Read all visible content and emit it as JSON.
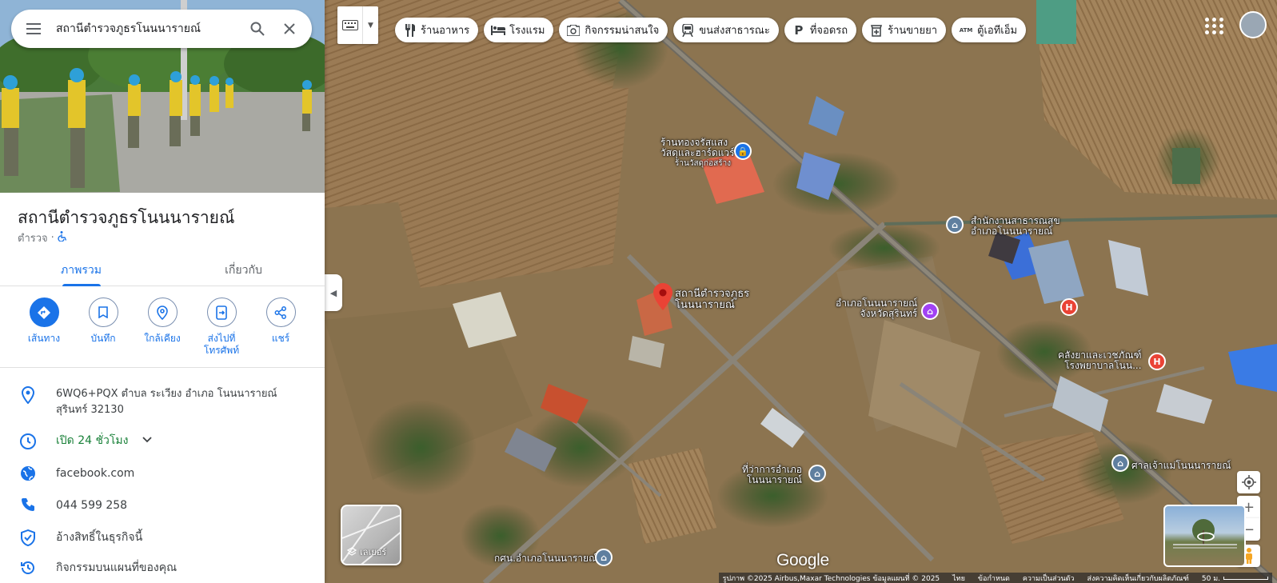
{
  "search": {
    "query": "สถานีตำรวจภูธรโนนนารายณ์"
  },
  "place": {
    "title": "สถานีตำรวจภูธรโนนนารายณ์",
    "category": "ตำรวจ",
    "separator": "·"
  },
  "tabs": [
    {
      "label": "ภาพรวม",
      "active": true
    },
    {
      "label": "เกี่ยวกับ",
      "active": false
    }
  ],
  "actions": [
    {
      "label": "เส้นทาง",
      "icon": "directions-icon"
    },
    {
      "label": "บันทึก",
      "icon": "bookmark-icon"
    },
    {
      "label": "ใกล้เคียง",
      "icon": "nearby-icon"
    },
    {
      "label": "ส่งไปที่\nโทรศัพท์",
      "icon": "send-to-phone-icon"
    },
    {
      "label": "แชร์",
      "icon": "share-icon"
    }
  ],
  "info": {
    "address_line1": "6WQ6+PQX ตำบล ระเวียง อำเภอ โนนนารายณ์",
    "address_line2": "สุรินทร์ 32130",
    "hours": "เปิด 24 ชั่วโมง",
    "website": "facebook.com",
    "phone": "044 599 258",
    "claim": "อ้างสิทธิ์ในธุรกิจนี้",
    "activity": "กิจกรรมบนแผนที่ของคุณ"
  },
  "chips": [
    {
      "label": "ร้านอาหาร",
      "icon": "restaurant-icon"
    },
    {
      "label": "โรงแรม",
      "icon": "hotel-icon"
    },
    {
      "label": "กิจกรรมน่าสนใจ",
      "icon": "camera-icon"
    },
    {
      "label": "ขนส่งสาธารณะ",
      "icon": "transit-icon"
    },
    {
      "label": "ที่จอดรถ",
      "icon": "parking-icon"
    },
    {
      "label": "ร้านขายยา",
      "icon": "pharmacy-icon"
    },
    {
      "label": "ตู้เอทีเอ็ม",
      "icon": "atm-icon"
    }
  ],
  "map_labels": {
    "shop_line1": "ร้านทองจรัสแสง",
    "shop_line2": "วัสดุและฮาร์ดแวร์",
    "shop_sub": "ร้านวัสดุก่อสร้าง",
    "selected_line1": "สถานีตำรวจภูธร",
    "selected_line2": "โนนนารายณ์",
    "health_line1": "สำนักงานสาธารณสุข",
    "health_line2": "อำเภอโนนนารายณ์",
    "district_line1": "อำเภอโนนนารายณ์",
    "district_line2": "จังหวัดสุรินทร์",
    "pharmacy_line1": "คลังยาและเวชภัณฑ์",
    "pharmacy_line2": "โรงพยาบาลโนน...",
    "office_line1": "ที่ว่าการอำเภอ",
    "office_line2": "โนนนารายณ์",
    "shrine": "ศาลเจ้าแม่โนนนารายณ์",
    "school": "กศน.อำเภอโนนนารายณ์"
  },
  "layers_label": "เลเยอร์",
  "google": "Google",
  "attribution": {
    "imagery": "รูปภาพ ©2025 Airbus,Maxar Technologies ข้อมูลแผนที่ © 2025",
    "lang": "ไทย",
    "terms": "ข้อกำหนด",
    "privacy": "ความเป็นส่วนตัว",
    "feedback": "ส่งความคิดเห็นเกี่ยวกับผลิตภัณฑ์",
    "scale": "50 ม."
  },
  "colors": {
    "accent": "#1a73e8",
    "open": "#188038",
    "marker": "#ea4335",
    "poi_purple": "#a142f4",
    "poi_gray": "#5f7f9f",
    "poi_blue": "#1a73e8"
  }
}
